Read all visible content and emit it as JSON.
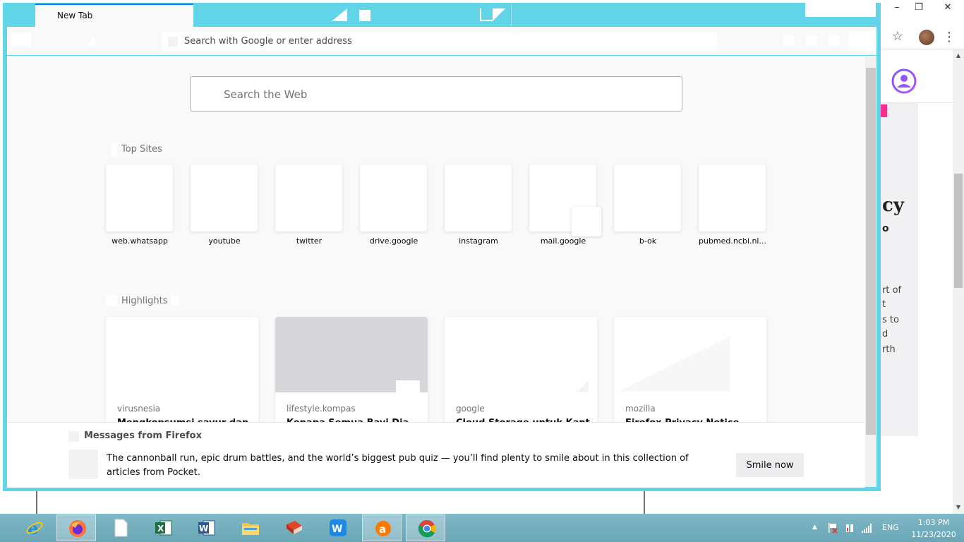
{
  "background_window": {
    "minimize_glyph": "–",
    "maximize_glyph": "❐",
    "close_glyph": "✕",
    "star_glyph": "☆",
    "menu_glyph": "⋮",
    "partial_heading": "cy",
    "partial_subheading": "o",
    "partial_lines": [
      "rt of",
      "t",
      "s to",
      "d",
      "rth"
    ],
    "accent_pink": "#ff2d8b",
    "account_icon": "account-circle-icon"
  },
  "firefox": {
    "tab_title": "New Tab",
    "url_placeholder": "Search with Google or enter address",
    "accent": "#0a84ff",
    "frame_color": "#62d4e8",
    "search_placeholder": "Search the Web",
    "top_sites_title": "Top Sites",
    "top_sites": [
      {
        "label": "web.whatsapp"
      },
      {
        "label": "youtube"
      },
      {
        "label": "twitter"
      },
      {
        "label": "drive.google"
      },
      {
        "label": "instagram"
      },
      {
        "label": "mail.google"
      },
      {
        "label": "b-ok"
      },
      {
        "label": "pubmed.ncbi.nl..."
      }
    ],
    "highlights_title": "Highlights",
    "highlights": [
      {
        "source": "virusnesia",
        "title": "Mengkonsumsi sayur dan M"
      },
      {
        "source": "lifestyle.kompas",
        "title": "Kenapa Semua Bayi Dia"
      },
      {
        "source": "google",
        "title": "Cloud Storage untuk Kant"
      },
      {
        "source": "mozilla",
        "title": "Firefox Privacy Notice — M"
      }
    ],
    "messages": {
      "header": "Messages from Firefox",
      "body": "The cannonball run, epic drum battles, and the world’s biggest pub quiz — you’ll find plenty to smile about in this collection of articles from Pocket.",
      "button": "Smile now"
    }
  },
  "taskbar": {
    "apps": [
      {
        "name": "internet-explorer-icon"
      },
      {
        "name": "firefox-icon"
      },
      {
        "name": "blank-document-icon"
      },
      {
        "name": "excel-icon"
      },
      {
        "name": "word-icon"
      },
      {
        "name": "file-explorer-icon"
      },
      {
        "name": "book-reader-icon"
      },
      {
        "name": "wps-office-icon"
      },
      {
        "name": "avast-icon"
      },
      {
        "name": "chrome-icon"
      }
    ],
    "tray_arrow": "▲",
    "language": "ENG",
    "time": "1:03 PM",
    "date": "11/23/2020"
  }
}
